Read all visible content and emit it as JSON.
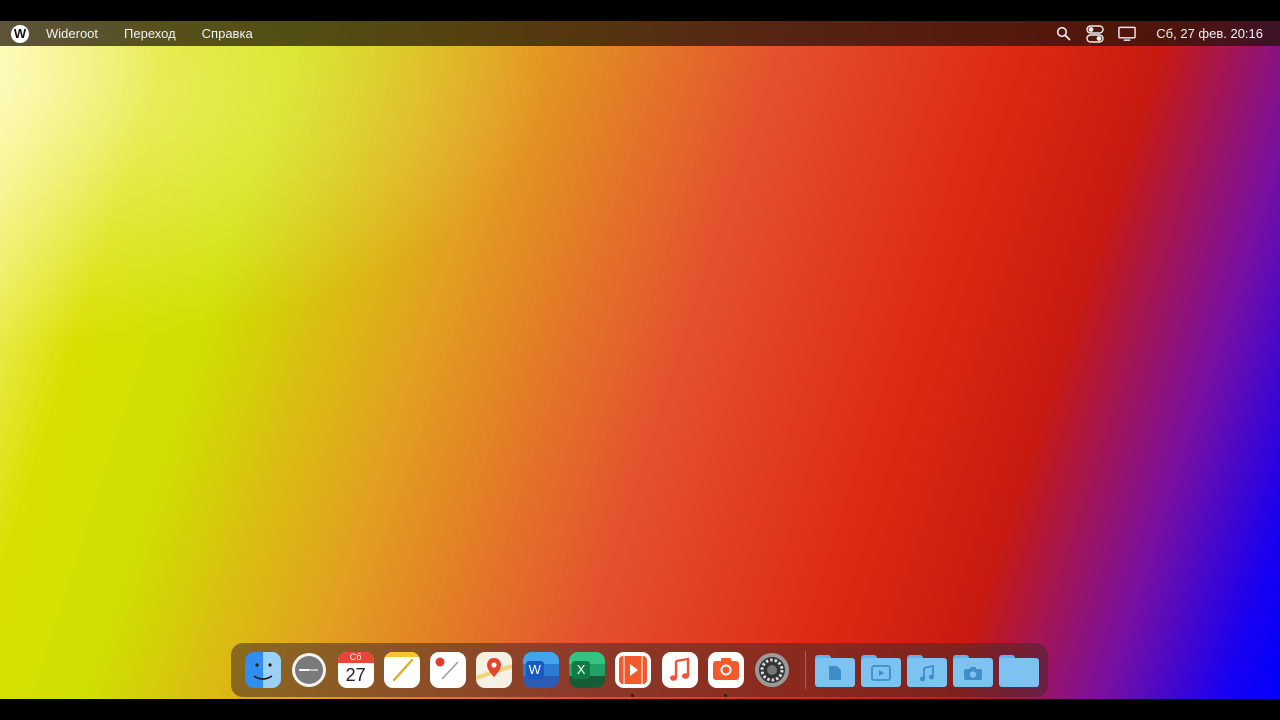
{
  "menubar": {
    "logo_letter": "W",
    "items": [
      "Wideroot",
      "Переход",
      "Справка"
    ],
    "clock": "Сб, 27 фев. 20:16",
    "icons": [
      "search-icon",
      "control-center-icon",
      "display-icon"
    ]
  },
  "dock": {
    "apps": [
      {
        "name": "finder",
        "running": false
      },
      {
        "name": "clock",
        "running": false
      },
      {
        "name": "calendar",
        "running": false,
        "weekday": "Сб",
        "day": "27"
      },
      {
        "name": "notes",
        "running": false
      },
      {
        "name": "reminders",
        "running": false
      },
      {
        "name": "maps",
        "running": false
      },
      {
        "name": "word",
        "running": false,
        "letter": "W"
      },
      {
        "name": "excel",
        "running": false,
        "letter": "X"
      },
      {
        "name": "video",
        "running": true
      },
      {
        "name": "music",
        "running": false
      },
      {
        "name": "photo-booth",
        "running": true
      },
      {
        "name": "settings",
        "running": false
      }
    ],
    "folders": [
      "documents-folder",
      "videos-folder",
      "music-folder",
      "pictures-folder",
      "blank-folder"
    ]
  },
  "colors": {
    "menubar": "#1e140a",
    "dock": "#462828",
    "folder": "#7cc3f2"
  }
}
